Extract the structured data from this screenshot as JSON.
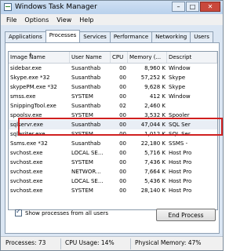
{
  "window": {
    "title": "Windows Task Manager",
    "min_glyph": "–",
    "max_glyph": "□",
    "close_glyph": "✕"
  },
  "menu": [
    "File",
    "Options",
    "View",
    "Help"
  ],
  "tabs": [
    "Applications",
    "Processes",
    "Services",
    "Performance",
    "Networking",
    "Users"
  ],
  "active_tab": "Processes",
  "columns": [
    "Image Name",
    "User Name",
    "CPU",
    "Memory (...",
    "Descript"
  ],
  "rows": [
    [
      "sidebar.exe",
      "Susanthab",
      "00",
      "8,960 K",
      "Window"
    ],
    [
      "Skype.exe *32",
      "Susanthab",
      "00",
      "57,252 K",
      "Skype"
    ],
    [
      "skypePM.exe *32",
      "Susanthab",
      "00",
      "9,628 K",
      "Skype"
    ],
    [
      "smss.exe",
      "SYSTEM",
      "00",
      "412 K",
      "Window"
    ],
    [
      "SnippingTool.exe",
      "Susanthab",
      "02",
      "2,460 K",
      ""
    ],
    [
      "spoolsv.exe",
      "SYSTEM",
      "00",
      "3,532 K",
      "Spooler"
    ],
    [
      "sqlservr.exe",
      "Susanthab",
      "00",
      "47,044 K",
      "SQL Ser"
    ],
    [
      "sqlwriter.exe",
      "SYSTEM",
      "00",
      "1,012 K",
      "SQL Ser"
    ],
    [
      "Ssms.exe *32",
      "Susanthab",
      "00",
      "22,180 K",
      "SSMS -"
    ],
    [
      "svchost.exe",
      "LOCAL SE...",
      "00",
      "5,716 K",
      "Host Pro"
    ],
    [
      "svchost.exe",
      "SYSTEM",
      "00",
      "7,436 K",
      "Host Pro"
    ],
    [
      "svchost.exe",
      "NETWOR...",
      "00",
      "7,664 K",
      "Host Pro"
    ],
    [
      "svchost.exe",
      "LOCAL SE...",
      "00",
      "5,436 K",
      "Host Pro"
    ],
    [
      "svchost.exe",
      "SYSTEM",
      "00",
      "28,140 K",
      "Host Pro"
    ]
  ],
  "selected_row": 6,
  "show_all_processes_label": "Show processes from all users",
  "show_all_processes_checked": true,
  "end_process_label": "End Process",
  "status": {
    "processes": "Processes: 73",
    "cpu": "CPU Usage: 14%",
    "memory": "Physical Memory: 47%"
  }
}
